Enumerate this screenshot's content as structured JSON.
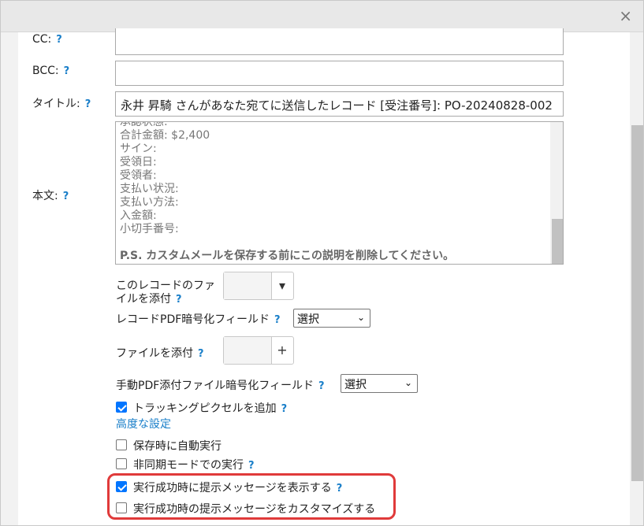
{
  "dialog": {
    "close_glyph": "×"
  },
  "help_glyph": "?",
  "fields": {
    "cc_label": "CC:",
    "cc_value": "",
    "bcc_label": "BCC:",
    "bcc_value": "",
    "title_label": "タイトル:",
    "title_value": "永井 昇騎 さんがあなた宛てに送信したレコード [受注番号]: PO-20240828-002",
    "body_label": "本文:"
  },
  "body_lines": [
    "承認状態:",
    "合計金額: $2,400",
    "サイン:",
    "受領日:",
    "受領者:",
    "支払い状況:",
    "支払い方法:",
    "入金額:",
    "小切手番号:"
  ],
  "body_note": "P.S. カスタムメールを保存する前にこの説明を削除してください。",
  "attach_record_file": {
    "label_line1": "このレコードのファ",
    "label_line2": "イルを添付",
    "button_icon": "▾"
  },
  "record_pdf_encrypt": {
    "label": "レコードPDF暗号化フィールド",
    "select_value": "選択"
  },
  "attach_file": {
    "label": "ファイルを添付",
    "button_icon": "+"
  },
  "manual_pdf_encrypt": {
    "label": "手動PDF添付ファイル暗号化フィールド",
    "select_value": "選択"
  },
  "options": {
    "tracking_pixel": {
      "label": "トラッキングピクセルを追加",
      "checked": true
    },
    "advanced_link": "高度な設定",
    "auto_run_on_save": {
      "label": "保存時に自動実行",
      "checked": false
    },
    "async_mode": {
      "label": "非同期モードでの実行",
      "checked": false
    },
    "show_success_message": {
      "label": "実行成功時に提示メッセージを表示する",
      "checked": true
    },
    "customize_success_message": {
      "label": "実行成功時の提示メッセージをカスタマイズする",
      "checked": false
    }
  },
  "colors": {
    "accent_blue": "#1a7fc9",
    "checkbox_blue": "#0075ff",
    "highlight_red": "#e03a3a"
  }
}
